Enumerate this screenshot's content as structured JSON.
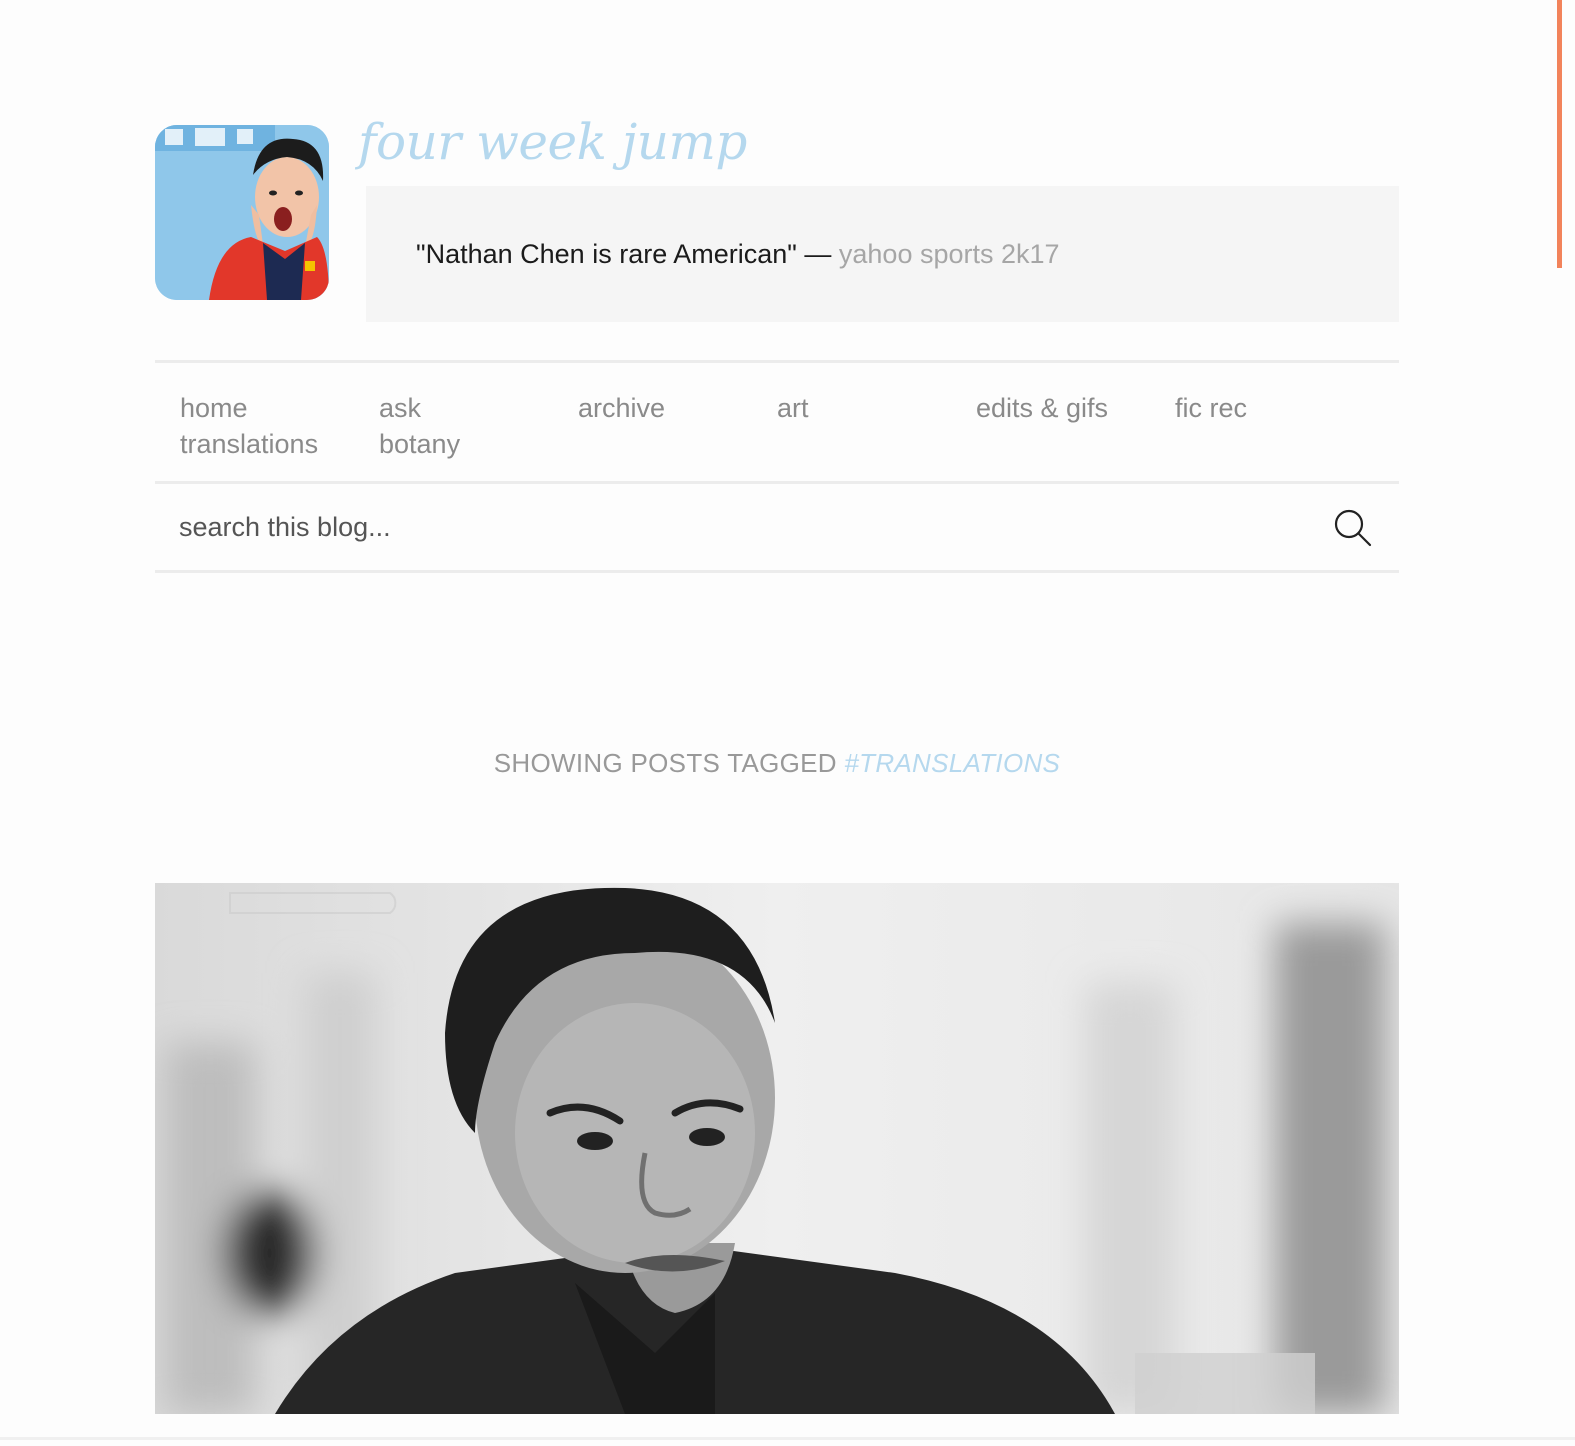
{
  "blog": {
    "title": "four week jump",
    "description": {
      "quote": "\"Nathan Chen is rare American\"",
      "dash": "—",
      "source": "yahoo sports 2k17"
    }
  },
  "nav": {
    "items": [
      {
        "label": "home"
      },
      {
        "label": "ask"
      },
      {
        "label": "archive"
      },
      {
        "label": "art"
      },
      {
        "label": "edits & gifs"
      },
      {
        "label": "fic rec"
      },
      {
        "label": "translations"
      },
      {
        "label": "botany"
      }
    ]
  },
  "search": {
    "placeholder": "search this blog...",
    "icon": "search-icon"
  },
  "tagged": {
    "prefix": "SHOWING POSTS TAGGED",
    "tag": "#TRANSLATIONS"
  },
  "colors": {
    "accent": "#b5d8ee",
    "scroll_indicator": "#f2835b",
    "description_bg": "#f5f5f5",
    "nav_text": "#8a8a8a"
  }
}
